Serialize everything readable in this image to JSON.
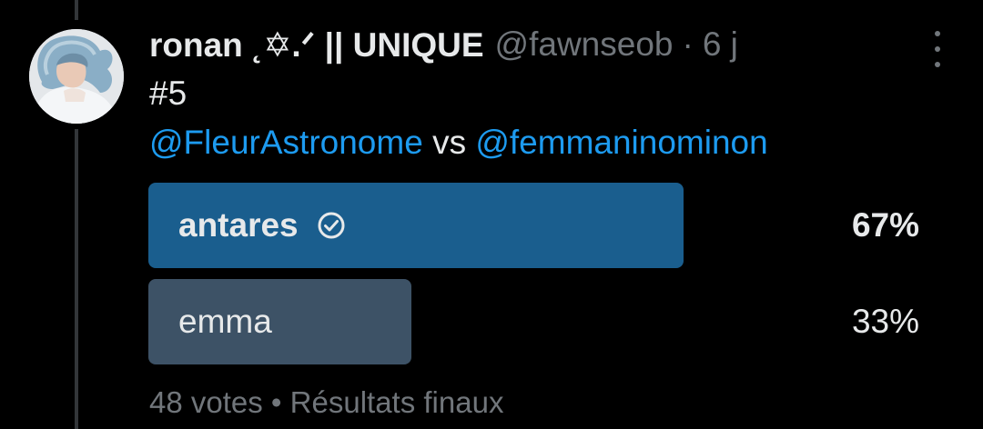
{
  "tweet": {
    "display_name": "ronan ˛✡︎.ᐟ || UNIQUE",
    "handle": "@fawnseob",
    "separator": "·",
    "time": "6 j",
    "line1": "#5",
    "mention_a": "@FleurAstronome",
    "vs": "vs",
    "mention_b": "@femmaninominon"
  },
  "poll": {
    "options": [
      {
        "label": "antares",
        "percent": "67%",
        "share": 0.67,
        "winner": true,
        "color": "#1a5e8e"
      },
      {
        "label": "emma",
        "percent": "33%",
        "share": 0.33,
        "winner": false,
        "color": "#3d5266"
      }
    ],
    "votes": "48 votes",
    "separator": "•",
    "status": "Résultats finaux"
  },
  "icons": {
    "more": "more-vertical-icon",
    "check": "check-circle-icon"
  }
}
